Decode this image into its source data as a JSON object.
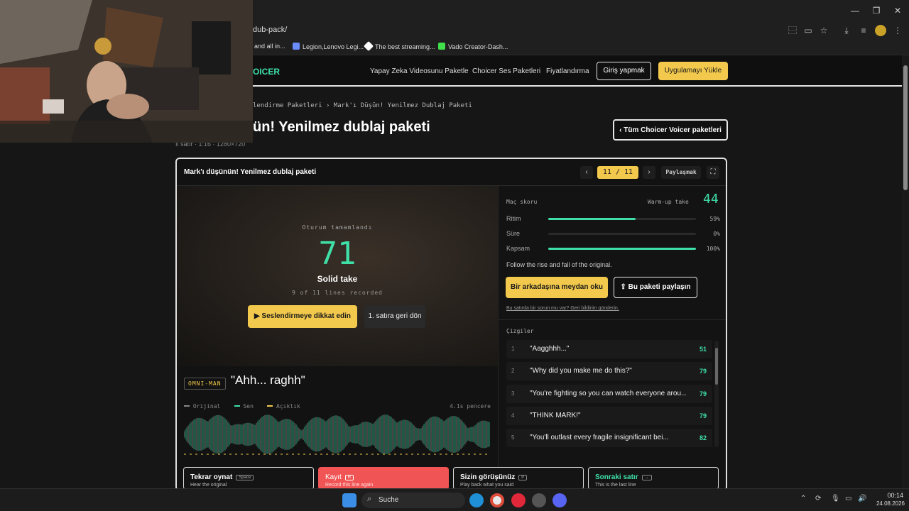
{
  "browser": {
    "url": "dub-pack/",
    "bookmarks": [
      {
        "label": "and all in...",
        "color": "#666666"
      },
      {
        "label": "Legion,Lenovo Legi...",
        "color": "#6b8cff"
      },
      {
        "label": "The best streaming...",
        "color": "#ffffff"
      },
      {
        "label": "Vado Creator-Dash...",
        "color": "#3fe04a"
      }
    ],
    "window_controls": [
      "—",
      "❐",
      "✕"
    ]
  },
  "site": {
    "logo": "OICER",
    "nav": [
      "Yapay Zeka Videosunu Paketle",
      "Choicer Ses Paketleri",
      "Fiyatlandırma"
    ],
    "login": "Giriş yapmak",
    "app_button": "Uygulamayı Yükle"
  },
  "page": {
    "breadcrumb": "lendirme Paketleri › Mark'ı Düşün! Yenilmez Dublaj Paketi",
    "title": "ün! Yenilmez dublaj paketi",
    "back_button": "‹ Tüm Choicer Voicer paketleri",
    "overlay_text": "ıl satır · 1:16 · 1280×720"
  },
  "card": {
    "title": "Mark'ı düşünün! Yenilmez dublaj paketi",
    "prev": "‹",
    "counter": "11 / 11",
    "next": "›",
    "share": "Paylaşmak",
    "fullscreen": "⛶"
  },
  "session": {
    "label": "Oturum tamamlandı",
    "score": "71",
    "verdict": "Solid take",
    "lines_recorded": "9 of 11 lines recorded",
    "primary_button": "▶ Seslendirmeye dikkat edin",
    "secondary_button": "1. satıra geri dön"
  },
  "match": {
    "label": "Maç skoru",
    "warmup_label": "Warm-up take",
    "warmup_score": "44",
    "metrics": [
      {
        "name": "Ritim",
        "pct_label": "59%",
        "value": 0.59
      },
      {
        "name": "Süre",
        "pct_label": "0%",
        "value": 0
      },
      {
        "name": "Kapsam",
        "pct_label": "100%",
        "value": 1.0
      }
    ],
    "hint": "Follow the rise and fall of the original.",
    "challenge_button": "Bir arkadaşına meydan oku",
    "share_pack_button": "⇪ Bu paketi paylaşın",
    "feedback_link": "Bu satırda bir sorun mu var? Geri bildirim gönderin."
  },
  "lines": {
    "label": "Çizgiler",
    "items": [
      {
        "num": "1",
        "text": "\"Aagghhh...\"",
        "score": "51"
      },
      {
        "num": "2",
        "text": "\"Why did you make me do this?\"",
        "score": "79"
      },
      {
        "num": "3",
        "text": "\"You're fighting so you can watch everyone arou...",
        "score": "79"
      },
      {
        "num": "4",
        "text": "\"THINK MARK!\"",
        "score": "79"
      },
      {
        "num": "5",
        "text": "\"You'll outlast every fragile insignificant bei...",
        "score": "82"
      }
    ]
  },
  "current_line": {
    "speaker": "OMNI-MAN",
    "quote": "\"Ahh... raghh\"",
    "legend": [
      "Orijinal",
      "Sen",
      "Açıklık"
    ],
    "legend_colors": [
      "#888888",
      "#3fe0a8",
      "#f2c94c"
    ],
    "window": "4.1s pencere"
  },
  "bottom_buttons": [
    {
      "title": "Tekrar oynat",
      "key": "Space",
      "sub": "Hear the original",
      "accent": "#141414"
    },
    {
      "title": "Kayıt",
      "key": "R",
      "sub": "Record this line again",
      "accent": "#f05454"
    },
    {
      "title": "Sizin görüşünüz",
      "key": "P",
      "sub": "Play back what you said",
      "accent": "#141414"
    },
    {
      "title": "Sonraki satır",
      "key": "→",
      "sub": "This is the last line",
      "accent": "#141414"
    }
  ],
  "taskbar": {
    "search": "Suche",
    "time": "00:14",
    "date": "24.08.2026"
  }
}
